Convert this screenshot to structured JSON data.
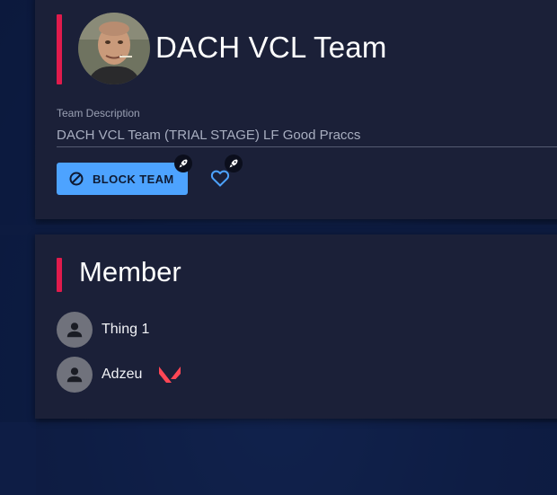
{
  "team": {
    "name": "DACH VCL Team",
    "description_label": "Team Description",
    "description": "DACH VCL Team (TRIAL STAGE) LF Good Praccs",
    "block_button_label": "BLOCK TEAM"
  },
  "members_section": {
    "title": "Member",
    "members": [
      {
        "name": "Thing 1",
        "game_icon": null
      },
      {
        "name": "Adzeu",
        "game_icon": "valorant-icon"
      }
    ]
  },
  "icons": {
    "block": "ban-icon",
    "favorite": "heart-outline-icon",
    "badge": "rocket-icon",
    "member_avatar": "person-icon"
  },
  "colors": {
    "accent": "#e01b4c",
    "button": "#4da3ff",
    "card": "#1b2038",
    "valorant": "#ff4655"
  }
}
